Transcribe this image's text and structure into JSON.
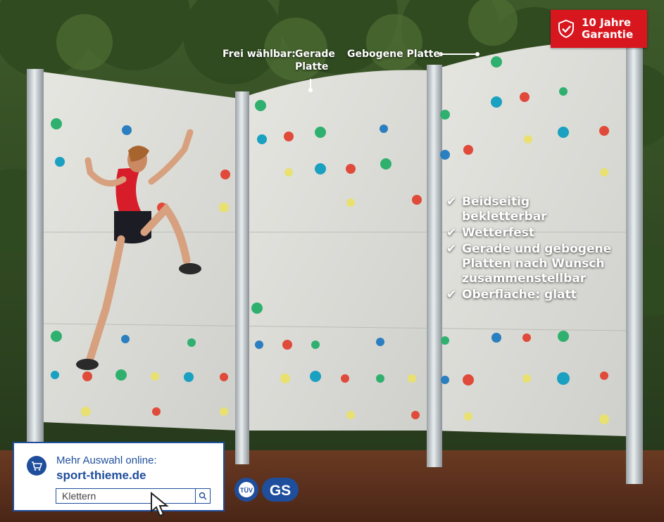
{
  "badge": {
    "text_line1": "10 Jahre",
    "text_line2": "Garantie",
    "icon": "shield-check-icon",
    "color": "#d8161e"
  },
  "labels": {
    "prefix": "Frei wählbar:",
    "straight_line1": "Gerade",
    "straight_line2": "Platte",
    "curved": "Gebogene Platte"
  },
  "features": [
    {
      "line1": "Beidseitig",
      "line2": "bekletterbar"
    },
    {
      "line1": "Wetterfest",
      "line2": ""
    },
    {
      "line1": "Gerade und gebogene",
      "line2": "Platten nach Wunsch",
      "line3": "zusammenstellbar"
    },
    {
      "line1": "Oberfläche: glatt",
      "line2": ""
    }
  ],
  "shop": {
    "line1": "Mehr Auswahl online:",
    "url": "sport-thieme.de",
    "search_value": "Klettern",
    "cart_icon": "cart-icon",
    "search_icon": "search-icon",
    "accent": "#1f4e9c"
  },
  "certifications": [
    "tuv-icon",
    "gs-icon"
  ]
}
